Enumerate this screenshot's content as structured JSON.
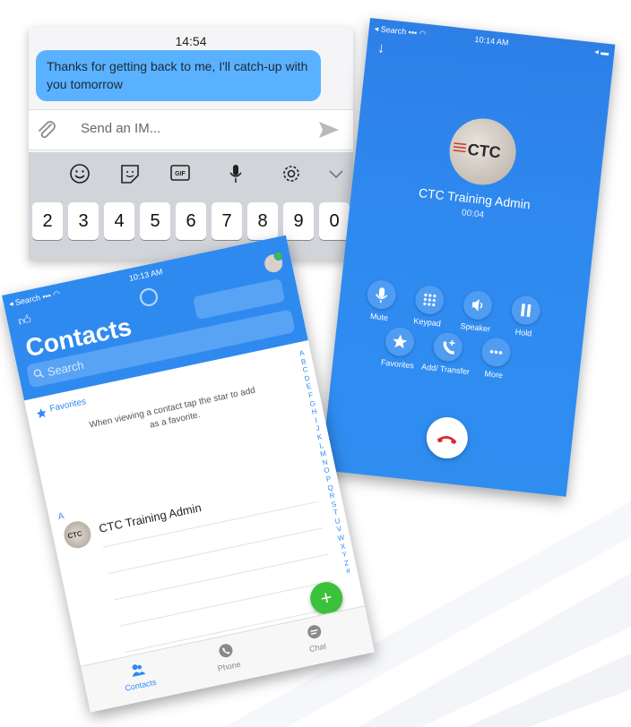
{
  "chat": {
    "time": "14:54",
    "message": "Thanks for getting back to me, I'll catch-up with you tomorrow",
    "composer_placeholder": "Send an IM...",
    "keys_row1": [
      "2",
      "3",
      "4",
      "5",
      "6",
      "7",
      "8",
      "9",
      "0"
    ],
    "toolbar_icons": [
      "emoji-icon",
      "sticker-icon",
      "gif-icon",
      "microphone-icon",
      "gear-icon",
      "chevron-down-icon"
    ]
  },
  "call": {
    "status_left": "Search",
    "status_time": "10:14 AM",
    "caller_name": "CTC Training Admin",
    "duration": "00:04",
    "avatar_text": "CTC",
    "controls": [
      {
        "label": "Mute",
        "icon": "microphone-icon"
      },
      {
        "label": "Keypad",
        "icon": "keypad-icon"
      },
      {
        "label": "Speaker",
        "icon": "speaker-icon"
      },
      {
        "label": "Hold",
        "icon": "pause-icon"
      },
      {
        "label": "Favorites",
        "icon": "star-icon"
      },
      {
        "label": "Add/ Transfer",
        "icon": "add-call-icon"
      },
      {
        "label": "More",
        "icon": "more-icon"
      }
    ],
    "accent": "#2f8af0",
    "hangup_color": "#e0262f"
  },
  "contacts": {
    "status_left": "Search",
    "status_time": "10:13 AM",
    "title": "Contacts",
    "search_placeholder": "Search",
    "favorites_label": "Favorites",
    "favorites_hint": "When viewing a contact tap the star to add as a favorite.",
    "section_letter": "A",
    "contact_name": "CTC Training Admin",
    "avatar_text": "CTC",
    "alphabet": "ABCDEFGHIJKLMNOPQRSTUVWXYZ#",
    "fab_label": "+",
    "tabs": [
      {
        "label": "Contacts",
        "icon": "contacts-icon",
        "active": true
      },
      {
        "label": "Phone",
        "icon": "phone-icon",
        "active": false
      },
      {
        "label": "Chat",
        "icon": "chat-icon",
        "active": false
      }
    ],
    "accent": "#2f8af0",
    "fab_color": "#3cc13b"
  }
}
